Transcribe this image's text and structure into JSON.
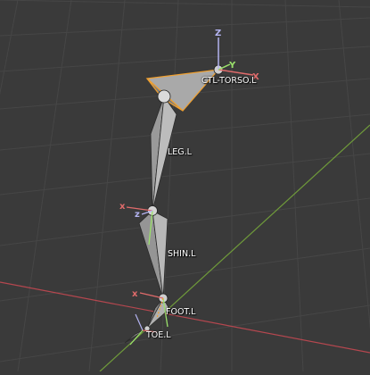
{
  "colors": {
    "background": "#3a3a3a",
    "grid_line": "#434343",
    "x_axis": "#b5474f",
    "y_axis": "#6f9a3a",
    "bone_fill": "#a6a6a6",
    "bone_selected_outline": "#f5a623",
    "gizmo_x": "#e06b6b",
    "gizmo_y": "#9ae06b",
    "gizmo_z": "#b3b3f0"
  },
  "bones": [
    {
      "label": "CTL-TORSO.L"
    },
    {
      "label": "LEG.L"
    },
    {
      "label": "SHIN.L"
    },
    {
      "label": "FOOT.L"
    },
    {
      "label": "TOE.L"
    }
  ],
  "gizmo": {
    "x_label": "x",
    "y_label": "y",
    "z_label": "z",
    "x_cap": "X",
    "y_cap": "Y",
    "z_cap": "Z"
  }
}
